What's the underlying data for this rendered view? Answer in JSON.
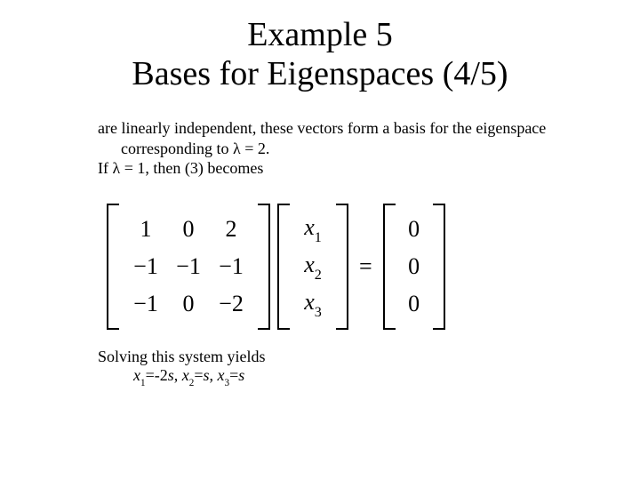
{
  "title_line1": "Example 5",
  "title_line2": "Bases for Eigenspaces (4/5)",
  "para_line1": "are linearly independent, these vectors form a basis for the eigenspace",
  "para_line2_pre": "corresponding to ",
  "para_line2_eq": "λ = 2.",
  "para_line3_pre": "If ",
  "para_line3_mid": "λ = 1",
  "para_line3_post": ", then (3) becomes",
  "matrix": {
    "A": [
      [
        "1",
        "0",
        "2"
      ],
      [
        "−1",
        "−1",
        "−1"
      ],
      [
        "−1",
        "0",
        "−2"
      ]
    ],
    "x": [
      "x_1",
      "x_2",
      "x_3"
    ],
    "b": [
      "0",
      "0",
      "0"
    ]
  },
  "eq_sign": "=",
  "yields_label": "Solving this system yields",
  "solution_parts": {
    "x1": "x",
    "s1": "1",
    "v1": "=-2",
    "x2": "x",
    "s2": "2",
    "v2": "=",
    "x3": "x",
    "s3": "3",
    "v3": "=",
    "s": "s",
    "sep": ", "
  },
  "chart_data": {
    "type": "table",
    "title": "Matrix equation (λI - A)x = 0 for λ = 1",
    "A": [
      [
        1,
        0,
        2
      ],
      [
        -1,
        -1,
        -1
      ],
      [
        -1,
        0,
        -2
      ]
    ],
    "x": [
      "x1",
      "x2",
      "x3"
    ],
    "b": [
      0,
      0,
      0
    ]
  }
}
